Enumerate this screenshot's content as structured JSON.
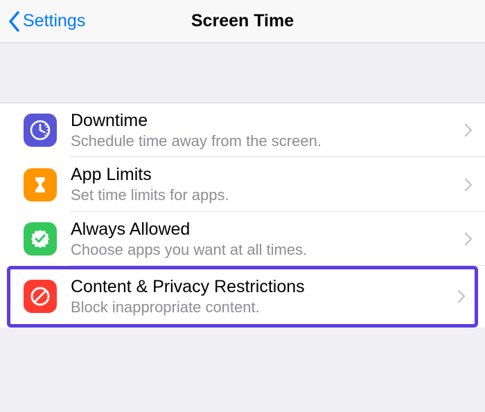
{
  "nav": {
    "back_label": "Settings",
    "title": "Screen Time"
  },
  "rows": [
    {
      "title": "Downtime",
      "subtitle": "Schedule time away from the screen."
    },
    {
      "title": "App Limits",
      "subtitle": "Set time limits for apps."
    },
    {
      "title": "Always Allowed",
      "subtitle": "Choose apps you want at all times."
    },
    {
      "title": "Content & Privacy Restrictions",
      "subtitle": "Block inappropriate content."
    }
  ],
  "colors": {
    "tint": "#007aff",
    "highlight_border": "#5b3de0"
  }
}
